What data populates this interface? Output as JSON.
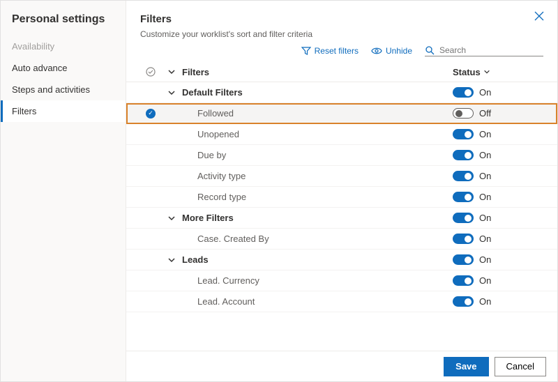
{
  "sidebar": {
    "title": "Personal settings",
    "items": [
      {
        "label": "Availability",
        "state": "disabled"
      },
      {
        "label": "Auto advance",
        "state": "normal"
      },
      {
        "label": "Steps and activities",
        "state": "normal"
      },
      {
        "label": "Filters",
        "state": "active"
      }
    ]
  },
  "header": {
    "title": "Filters",
    "subtitle": "Customize your worklist's sort and filter criteria"
  },
  "toolbar": {
    "reset": "Reset filters",
    "unhide": "Unhide",
    "search_placeholder": "Search"
  },
  "columns": {
    "name": "Filters",
    "status": "Status"
  },
  "status_labels": {
    "on": "On",
    "off": "Off"
  },
  "rows": [
    {
      "type": "group",
      "label": "Default Filters",
      "status": "on",
      "checked": false,
      "highlight": false
    },
    {
      "type": "item",
      "label": "Followed",
      "status": "off",
      "checked": true,
      "highlight": true
    },
    {
      "type": "item",
      "label": "Unopened",
      "status": "on",
      "checked": false,
      "highlight": false
    },
    {
      "type": "item",
      "label": "Due by",
      "status": "on",
      "checked": false,
      "highlight": false
    },
    {
      "type": "item",
      "label": "Activity type",
      "status": "on",
      "checked": false,
      "highlight": false
    },
    {
      "type": "item",
      "label": "Record type",
      "status": "on",
      "checked": false,
      "highlight": false
    },
    {
      "type": "group",
      "label": "More Filters",
      "status": "on",
      "checked": false,
      "highlight": false
    },
    {
      "type": "item",
      "label": "Case. Created By",
      "status": "on",
      "checked": false,
      "highlight": false
    },
    {
      "type": "group",
      "label": "Leads",
      "status": "on",
      "checked": false,
      "highlight": false
    },
    {
      "type": "item",
      "label": "Lead. Currency",
      "status": "on",
      "checked": false,
      "highlight": false
    },
    {
      "type": "item",
      "label": "Lead. Account",
      "status": "on",
      "checked": false,
      "highlight": false
    }
  ],
  "footer": {
    "save": "Save",
    "cancel": "Cancel"
  }
}
